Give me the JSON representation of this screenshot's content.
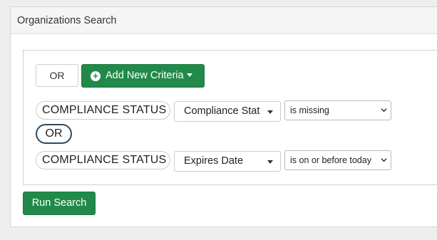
{
  "panel": {
    "title": "Organizations Search"
  },
  "toolbar": {
    "or_label": "OR",
    "add_criteria_label": "Add New Criteria",
    "plus_icon": "plus-circle-icon",
    "caret_icon": "caret-down-icon"
  },
  "criteria": [
    {
      "field_label": "COMPLIANCE STATUS",
      "field_select": "Compliance Stat",
      "operator": "is missing"
    },
    {
      "field_label": "COMPLIANCE STATUS",
      "field_select": "Expires Date",
      "operator": "is on or before today"
    }
  ],
  "connector": {
    "label": "OR"
  },
  "actions": {
    "run_search_label": "Run Search"
  },
  "colors": {
    "accent": "#218a4a",
    "connector_border": "#2e4a60"
  }
}
